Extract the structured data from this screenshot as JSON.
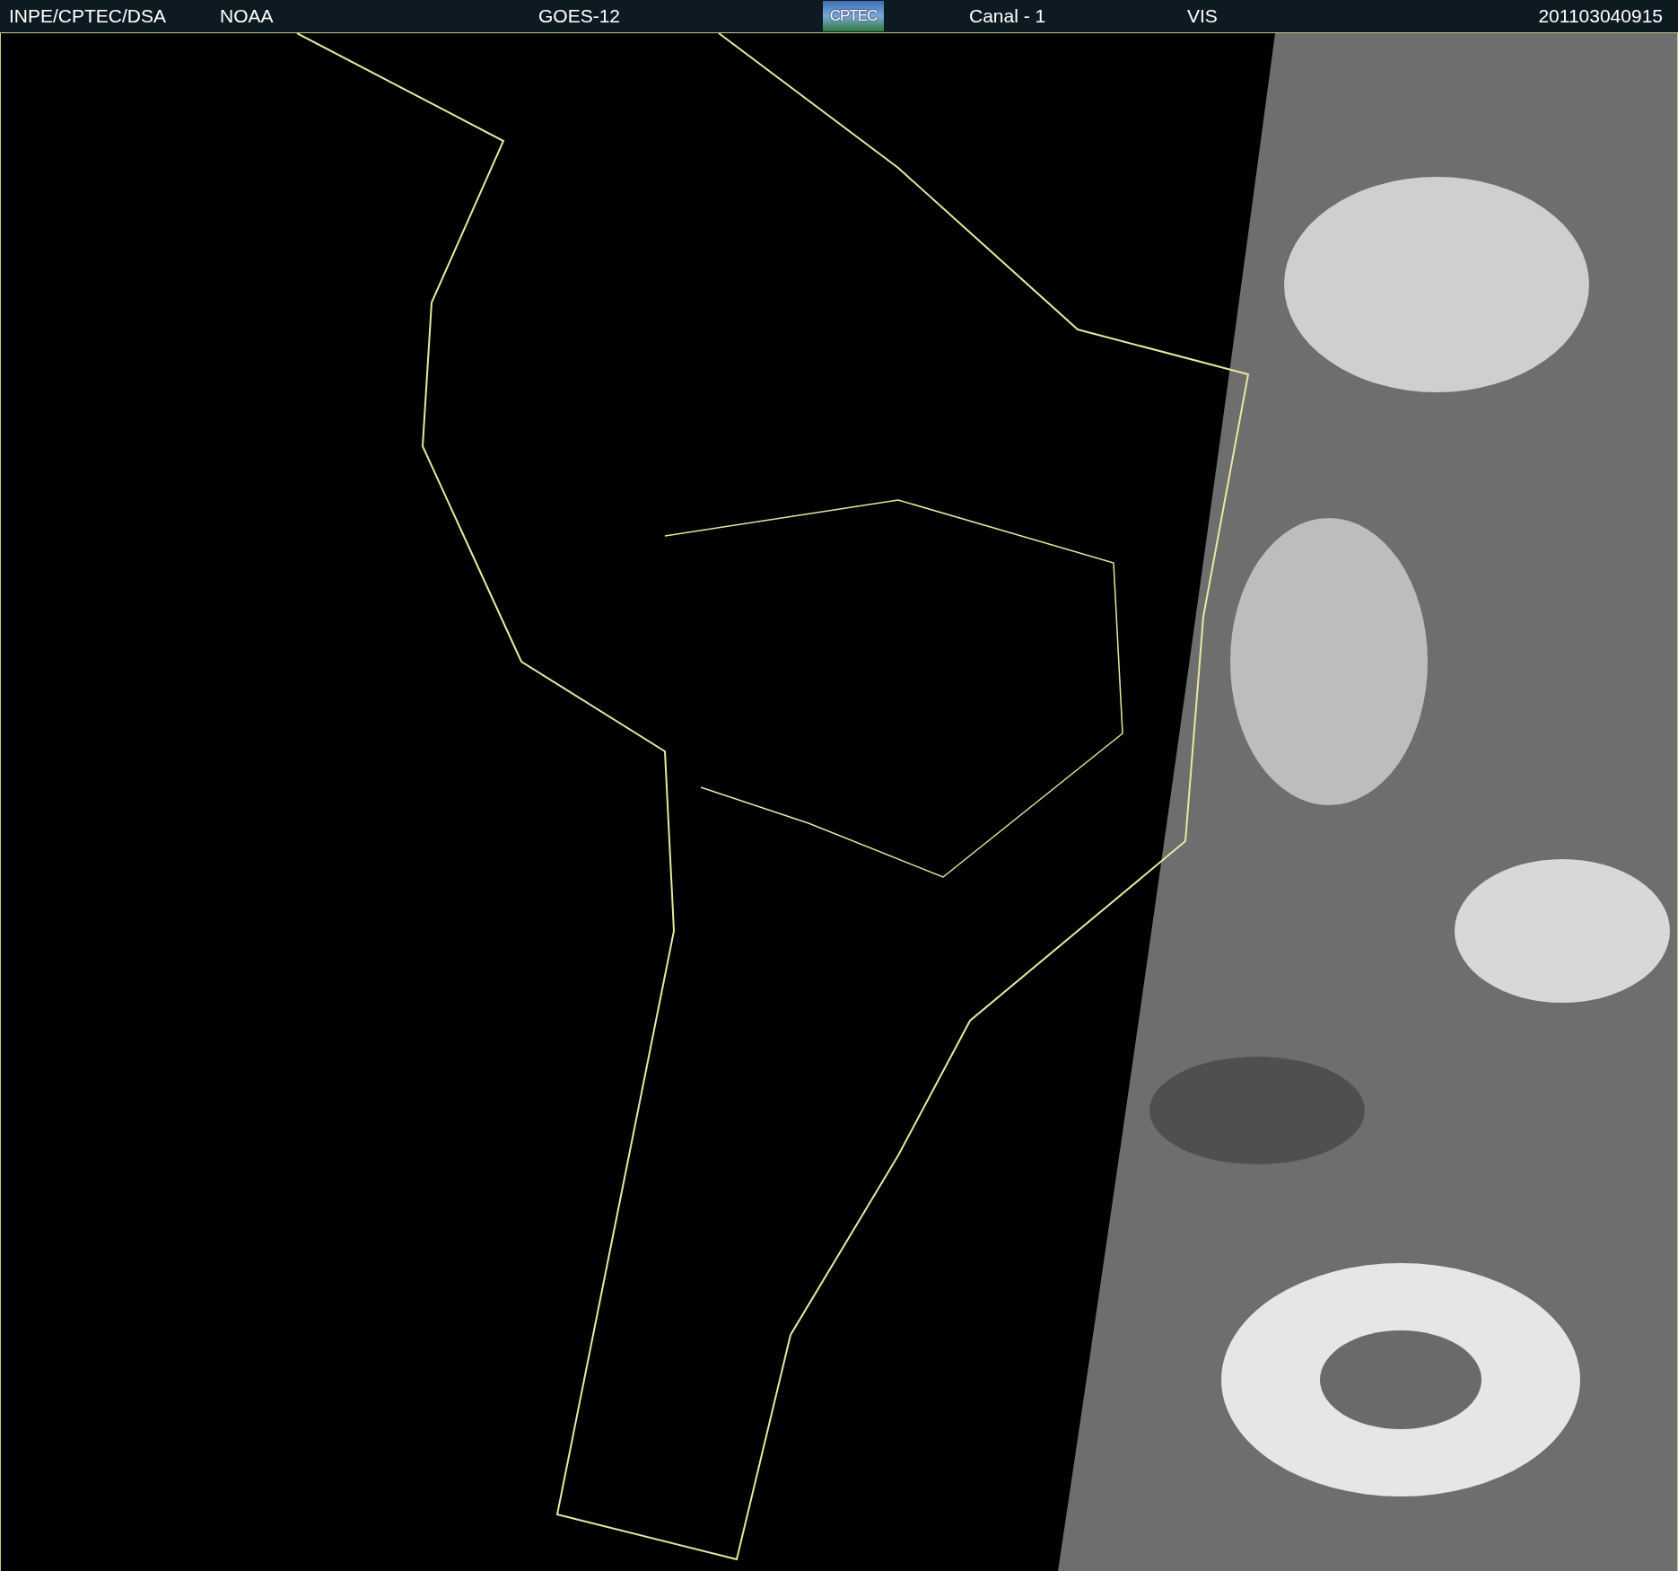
{
  "header": {
    "source": "INPE/CPTEC/DSA",
    "agency": "NOAA",
    "satellite": "GOES-12",
    "logo": "CPTEC",
    "channel": "Canal - 1",
    "band": "VIS",
    "timestamp": "201103040915"
  }
}
